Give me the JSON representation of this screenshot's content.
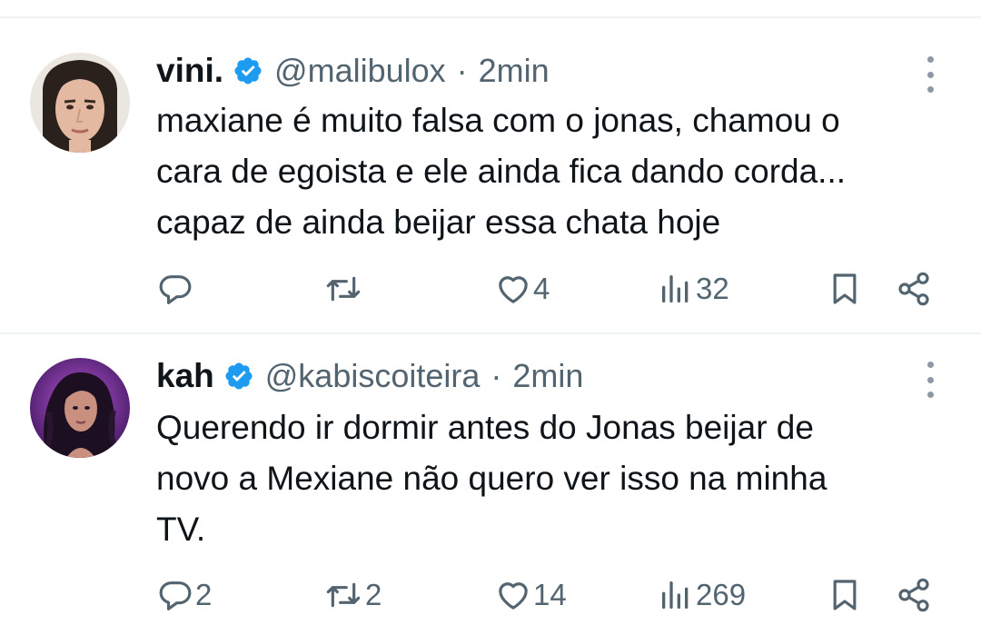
{
  "colors": {
    "text": "#0f1419",
    "secondary": "#536471",
    "verified": "#1d9bf0",
    "divider": "#eff3f4"
  },
  "tweets": [
    {
      "display_name": "vini.",
      "handle": "@malibulox",
      "separator": "·",
      "time": "2min",
      "text": "maxiane é muito falsa com o jonas, chamou o\ncara de egoista e ele ainda fica dando corda...\ncapaz de ainda beijar essa chata hoje",
      "replies": "",
      "retweets": "",
      "likes": "4",
      "views": "32",
      "icons": [
        "reply-icon",
        "retweet-icon",
        "like-icon",
        "views-icon",
        "bookmark-icon",
        "share-icon",
        "more-icon",
        "verified-badge-icon"
      ]
    },
    {
      "display_name": "kah",
      "handle": "@kabiscoiteira",
      "separator": "·",
      "time": "2min",
      "text": "Querendo ir dormir antes do Jonas beijar de\nnovo a Mexiane não quero ver isso na minha\nTV.",
      "replies": "2",
      "retweets": "2",
      "likes": "14",
      "views": "269",
      "icons": [
        "reply-icon",
        "retweet-icon",
        "like-icon",
        "views-icon",
        "bookmark-icon",
        "share-icon",
        "more-icon",
        "verified-badge-icon"
      ]
    }
  ]
}
